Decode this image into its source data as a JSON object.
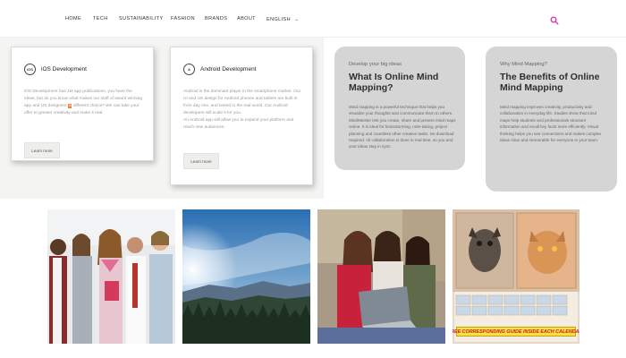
{
  "nav": {
    "items": [
      "HOME",
      "TECH",
      "SUSTAINABILITY",
      "FASHION",
      "BRANDS",
      "ABOUT",
      "ENGLISH"
    ],
    "search_icon": "search-icon",
    "accent": "#d63ab8"
  },
  "dev_cards": [
    {
      "logo": "iOS",
      "title": "iOS Development",
      "text_a": "iOS Development has 1M app publications, you have the ideas, but do you know what makes our staff of award winning app and UX designers ",
      "text_hl": "a",
      "text_b": " different choice? We can take your offer to greater creativity and make it real.",
      "button": "Learn more"
    },
    {
      "logo": "A",
      "title": "Android Development",
      "text": "Android is the dominant player in the smartphone market. Our UI and UX design for Android phones and tablets are built in from day one, and tested in the real world. Our Android developers will scale it for you.",
      "text2": "An Android app will allow you to expand your platform and reach new audiences.",
      "button": "Learn more"
    }
  ],
  "mind_cards": [
    {
      "kicker": "Develop your big ideas",
      "title": "What Is Online Mind Mapping?",
      "text": "Mind mapping is a powerful technique that helps you visualize your thoughts and communicate them to others. MindMeister lets you create, share and present mind maps online. It is ideal for brainstorming, note-taking, project planning and countless other creative tasks. No download required. All collaboration is done in real time, so you and your ideas stay in sync."
    },
    {
      "kicker": "Why Mind Mapping?",
      "title": "The Benefits of Online Mind Mapping",
      "text": "Mind mapping improves creativity, productivity and collaboration in everyday life. Studies show that mind maps help students and professionals structure information and recall key facts more efficiently. Visual thinking helps you see connections and makes complex ideas clear and memorable for everyone in your team."
    }
  ],
  "photos": {
    "calendar_banner": "FREE CORRESPONDING GUIDE INSIDE EACH CALENDAR!"
  }
}
